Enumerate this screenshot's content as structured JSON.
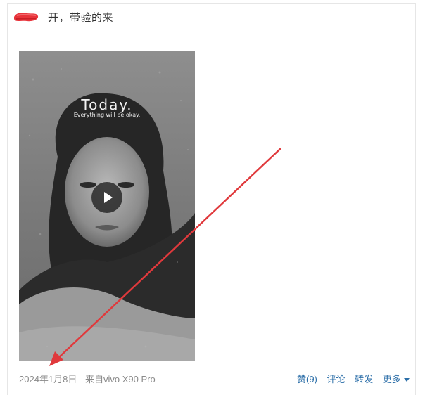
{
  "post": {
    "text": "开，带验的来"
  },
  "media": {
    "title": "Today.",
    "subtitle": "Everything will be okay."
  },
  "meta": {
    "date": "2024年1月8日",
    "source": "来自vivo X90 Pro"
  },
  "actions": {
    "like": "赞(9)",
    "comment": "评论",
    "repost": "转发",
    "more": "更多"
  },
  "colors": {
    "link": "#2b6ea8",
    "meta_text": "#8a8a8a",
    "annotation_arrow": "#e0393c",
    "redaction": "#e8333a"
  }
}
